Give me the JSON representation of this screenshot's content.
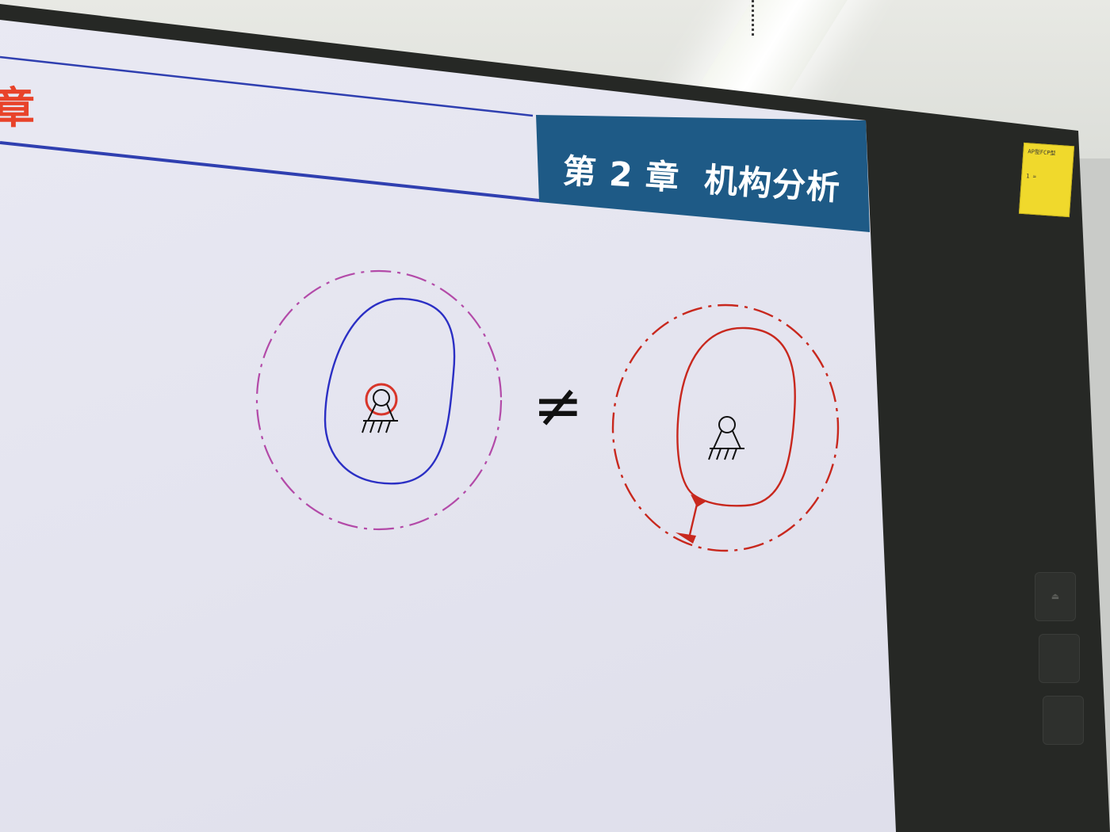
{
  "slide": {
    "header_title": "第 2 章  机构分析",
    "header_left_fragment": "章",
    "inequality_symbol": "≠"
  },
  "colors": {
    "header_bar": "#1e5a86",
    "header_text": "#ffffff",
    "left_title": "#e8432a",
    "rule_line": "#2f3fb0",
    "left_dashed_circle": "#b34aa8",
    "left_closed_curve": "#2b2fc4",
    "right_diagram": "#c8281e",
    "symbol": "#111111"
  },
  "icons": {
    "fixed_pivot_left": "fixed-pivot-icon",
    "fixed_pivot_right": "fixed-pivot-icon",
    "monitor_buttons": [
      "eject-icon",
      "button-icon",
      "button-icon"
    ]
  },
  "sticker": {
    "line1": "AP型FCP型",
    "line2": "1 ="
  }
}
